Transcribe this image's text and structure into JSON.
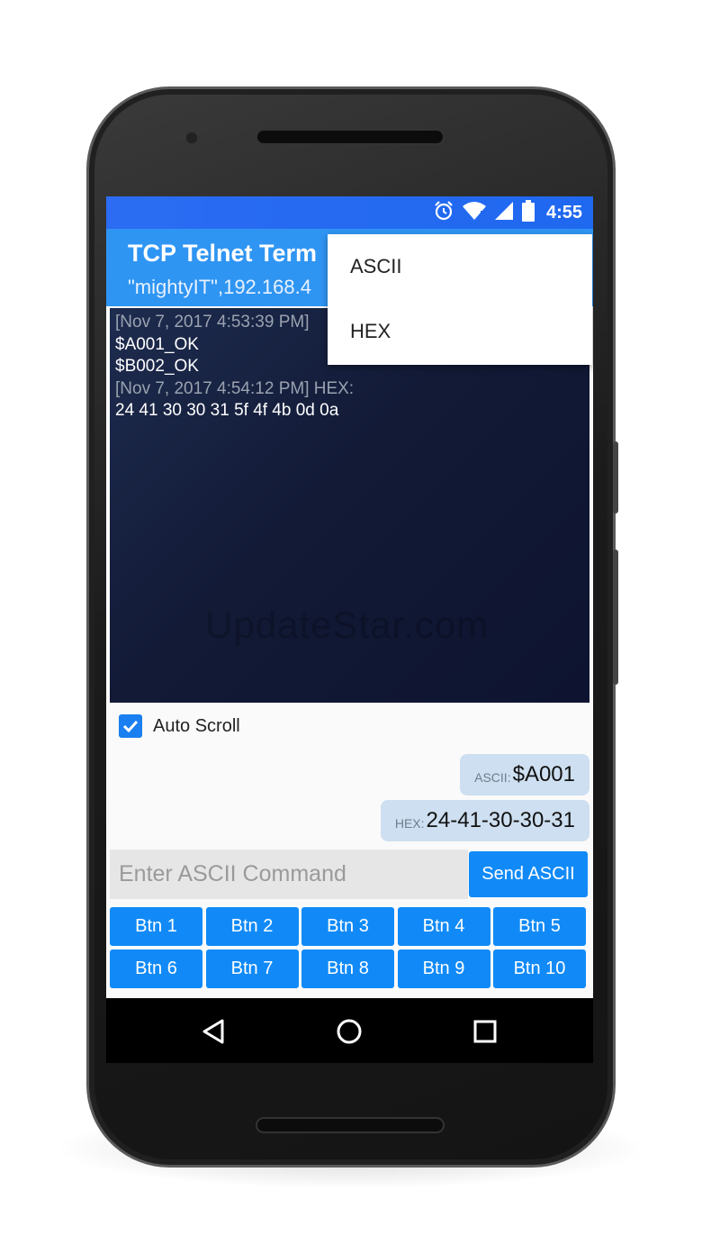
{
  "status_bar": {
    "time": "4:55",
    "icons": [
      "alarm-icon",
      "wifi-icon",
      "signal-icon",
      "battery-icon"
    ]
  },
  "app_bar": {
    "title": "TCP Telnet Term",
    "subtitle": "\"mightyIT\",192.168.4"
  },
  "menu": {
    "items": [
      "ASCII",
      "HEX"
    ]
  },
  "terminal": {
    "lines": [
      {
        "kind": "stamp",
        "text": "[Nov 7, 2017 4:53:39 PM]"
      },
      {
        "kind": "data",
        "text": "$A001_OK"
      },
      {
        "kind": "data",
        "text": "$B002_OK"
      },
      {
        "kind": "stamp",
        "text": "[Nov 7, 2017 4:54:12 PM] HEX:"
      },
      {
        "kind": "data",
        "text": "24 41 30 30 31 5f 4f 4b 0d 0a"
      }
    ],
    "watermark": "UpdateStar.com"
  },
  "auto_scroll": {
    "label": "Auto Scroll",
    "checked": true
  },
  "sent": {
    "ascii": {
      "tag": "ASCII:",
      "value": "$A001"
    },
    "hex": {
      "tag": "HEX:",
      "value": "24-41-30-30-31"
    }
  },
  "command": {
    "placeholder": "Enter ASCII Command",
    "value": "",
    "send_label": "Send ASCII"
  },
  "buttons": [
    "Btn 1",
    "Btn 2",
    "Btn 3",
    "Btn 4",
    "Btn 5",
    "Btn 6",
    "Btn 7",
    "Btn 8",
    "Btn 9",
    "Btn 10"
  ],
  "colors": {
    "accent": "#118af7",
    "status_bar": "#1f68f0",
    "app_bar": "#2f95f3",
    "terminal_bg": "#121a36"
  }
}
